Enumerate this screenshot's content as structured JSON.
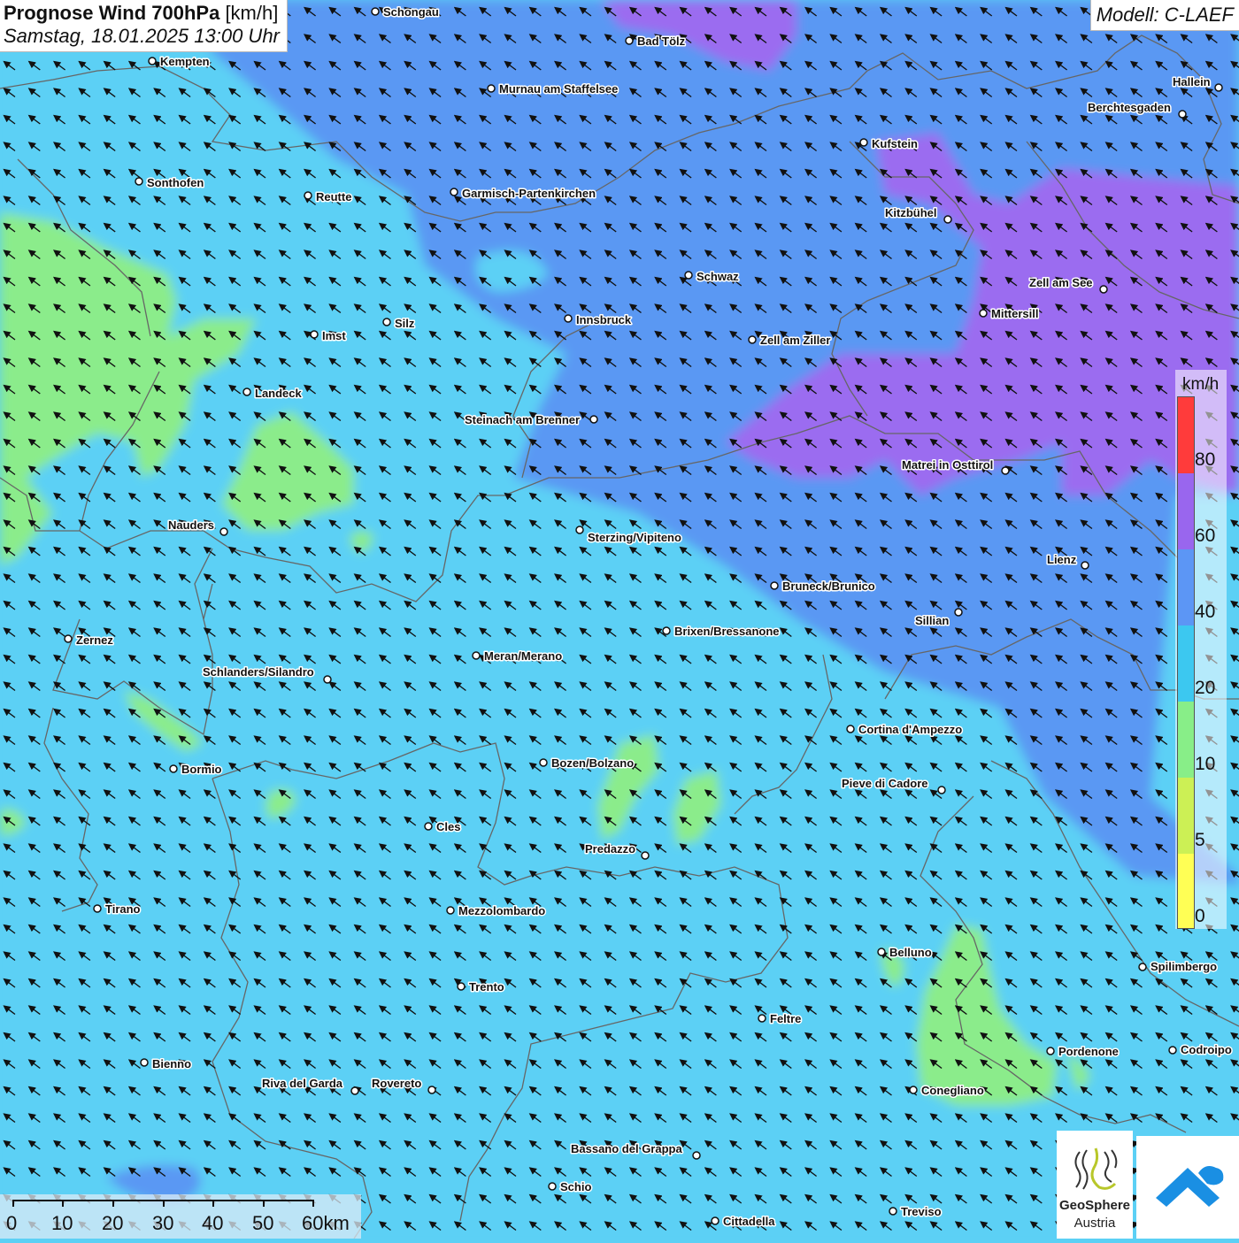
{
  "header": {
    "title_bold": "Prognose Wind 700hPa",
    "title_unit": "[km/h]",
    "datetime": "Samstag, 18.01.2025 13:00 Uhr",
    "model": "Modell: C-LAEF"
  },
  "legend": {
    "unit": "km/h",
    "classes": [
      {
        "label": "0",
        "color": "#ffff55"
      },
      {
        "label": "5",
        "color": "#ccf055"
      },
      {
        "label": "10",
        "color": "#88ee88"
      },
      {
        "label": "20",
        "color": "#3cc8f0"
      },
      {
        "label": "40",
        "color": "#5c96f5"
      },
      {
        "label": "60",
        "color": "#9966ee"
      },
      {
        "label": "80",
        "color": "#ff3b3b"
      }
    ]
  },
  "scalebar": {
    "labels": [
      "0",
      "10",
      "20",
      "30",
      "40",
      "50",
      "60km"
    ]
  },
  "map": {
    "wind_direction": "north-west",
    "cities": [
      {
        "name": "Schongau"
      },
      {
        "name": "Bad Tölz"
      },
      {
        "name": "Kempten"
      },
      {
        "name": "Murnau am Staffelsee"
      },
      {
        "name": "Hallein"
      },
      {
        "name": "Berchtesgaden"
      },
      {
        "name": "Kufstein"
      },
      {
        "name": "Sonthofen"
      },
      {
        "name": "Reutte"
      },
      {
        "name": "Garmisch-Partenkirchen"
      },
      {
        "name": "Kitzbühel"
      },
      {
        "name": "Schwaz"
      },
      {
        "name": "Zell am See"
      },
      {
        "name": "Mittersill"
      },
      {
        "name": "Innsbruck"
      },
      {
        "name": "Silz"
      },
      {
        "name": "Imst"
      },
      {
        "name": "Zell am Ziller"
      },
      {
        "name": "Landeck"
      },
      {
        "name": "Steinach am Brenner"
      },
      {
        "name": "Matrei in Osttirol"
      },
      {
        "name": "Nauders"
      },
      {
        "name": "Sterzing/Vipiteno"
      },
      {
        "name": "Lienz"
      },
      {
        "name": "Bruneck/Brunico"
      },
      {
        "name": "Sillian"
      },
      {
        "name": "Brixen/Bressanone"
      },
      {
        "name": "Zernez"
      },
      {
        "name": "Meran/Merano"
      },
      {
        "name": "Schlanders/Silandro"
      },
      {
        "name": "Cortina d'Ampezzo"
      },
      {
        "name": "Bozen/Bolzano"
      },
      {
        "name": "Bormio"
      },
      {
        "name": "Pieve di Cadore"
      },
      {
        "name": "Cles"
      },
      {
        "name": "Predazzo"
      },
      {
        "name": "Tirano"
      },
      {
        "name": "Mezzolombardo"
      },
      {
        "name": "Belluno"
      },
      {
        "name": "Spilimbergo"
      },
      {
        "name": "Trento"
      },
      {
        "name": "Feltre"
      },
      {
        "name": "Pordenone"
      },
      {
        "name": "Codroipo"
      },
      {
        "name": "Bienno"
      },
      {
        "name": "Riva del Garda"
      },
      {
        "name": "Rovereto"
      },
      {
        "name": "Conegliano"
      },
      {
        "name": "Bassano del Grappa"
      },
      {
        "name": "Schio"
      },
      {
        "name": "Treviso"
      },
      {
        "name": "Cittadella"
      }
    ]
  },
  "logos": {
    "geosphere_name": "GeoSphere",
    "geosphere_sub": "Austria"
  }
}
